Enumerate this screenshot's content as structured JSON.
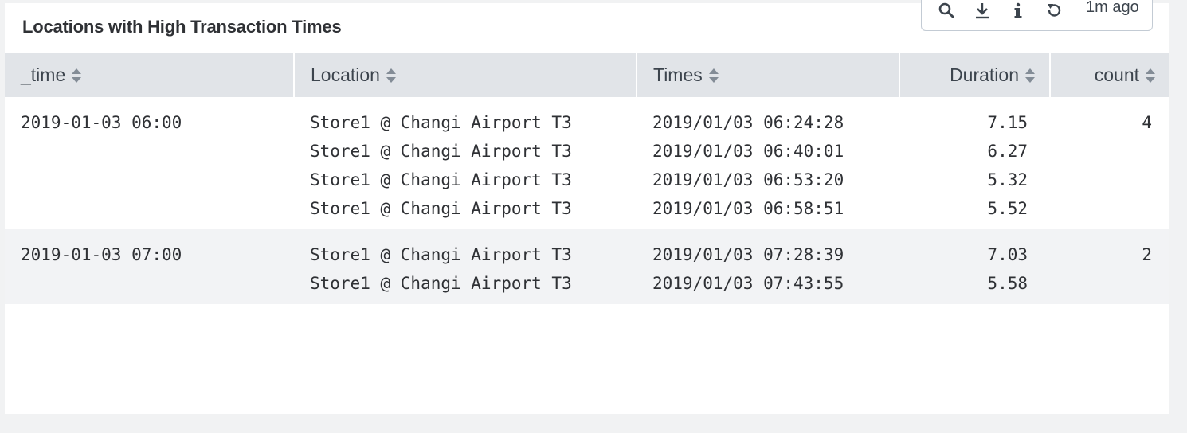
{
  "panel": {
    "title": "Locations with High Transaction Times",
    "toolbar": {
      "icons": [
        "search-icon",
        "download-icon",
        "info-icon",
        "refresh-icon"
      ],
      "last_refresh": "1m ago"
    }
  },
  "table": {
    "columns": [
      "_time",
      "Location",
      "Times",
      "Duration",
      "count"
    ],
    "rows": [
      {
        "_time": "2019-01-03 06:00",
        "Location": [
          "Store1 @ Changi Airport T3",
          "Store1 @ Changi Airport T3",
          "Store1 @ Changi Airport T3",
          "Store1 @ Changi Airport T3"
        ],
        "Times": [
          "2019/01/03 06:24:28",
          "2019/01/03 06:40:01",
          "2019/01/03 06:53:20",
          "2019/01/03 06:58:51"
        ],
        "Duration": [
          "7.15",
          "6.27",
          "5.32",
          "5.52"
        ],
        "count": "4"
      },
      {
        "_time": "2019-01-03 07:00",
        "Location": [
          "Store1 @ Changi Airport T3",
          "Store1 @ Changi Airport T3"
        ],
        "Times": [
          "2019/01/03 07:28:39",
          "2019/01/03 07:43:55"
        ],
        "Duration": [
          "7.03",
          "5.58"
        ],
        "count": "2"
      }
    ]
  },
  "colors": {
    "header_bg": "#e1e4e8",
    "alt_row_bg": "#f2f3f5",
    "page_bg": "#f1f2f3",
    "text": "#2f3135"
  }
}
